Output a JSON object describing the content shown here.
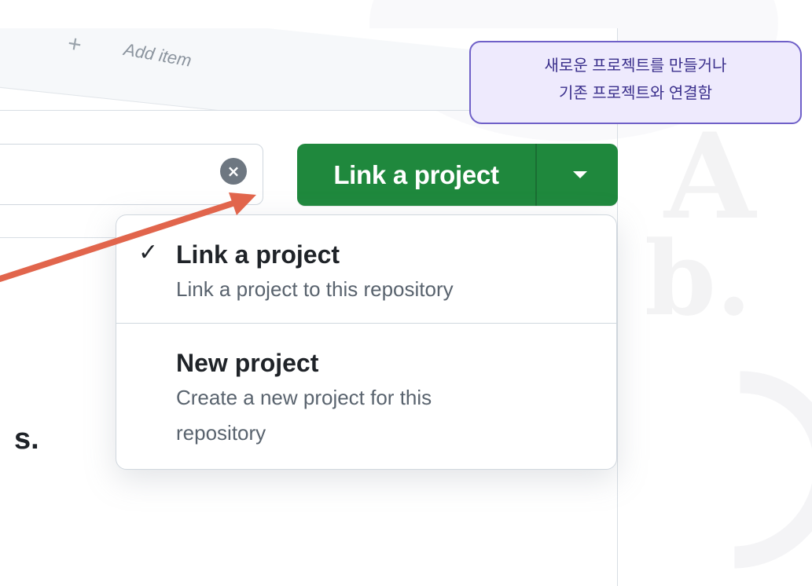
{
  "board_preview": {
    "plus_symbol": "+",
    "add_item_label": "Add item"
  },
  "filter": {
    "clear_symbol": "×"
  },
  "split_button": {
    "label": "Link a project"
  },
  "menu": {
    "items": [
      {
        "title": "Link a project",
        "description": "Link a project to this repository",
        "selected": true
      },
      {
        "title": "New project",
        "description": "Create a new project for this repository",
        "selected": false
      }
    ],
    "check_symbol": "✓"
  },
  "fragment_text": "s.",
  "annotation": {
    "line1": "새로운 프로젝트를 만들거나",
    "line2": "기존 프로젝트와 연결함",
    "arrow_color": "#e1654c",
    "border_color": "#6f60c8",
    "fill_color": "#eeeafd"
  },
  "colors": {
    "primary_green": "#1f883d",
    "text_primary": "#1f2328",
    "text_muted": "#59636e"
  }
}
